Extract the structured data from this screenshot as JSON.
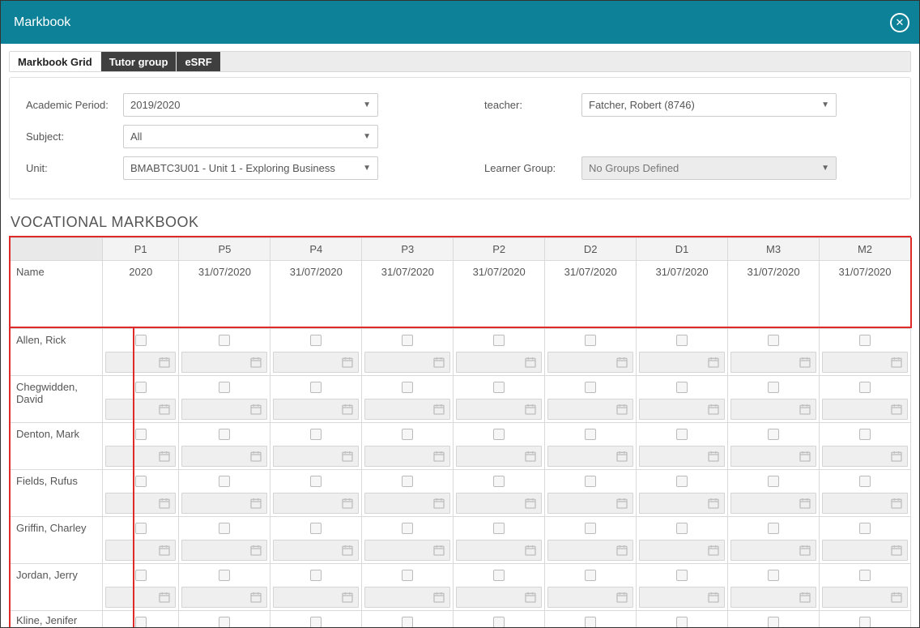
{
  "window": {
    "title": "Markbook"
  },
  "tabs": [
    {
      "label": "Markbook Grid",
      "active": true
    },
    {
      "label": "Tutor group",
      "active": false
    },
    {
      "label": "eSRF",
      "active": false
    }
  ],
  "filters": {
    "academic_period": {
      "label": "Academic Period:",
      "value": "2019/2020"
    },
    "subject": {
      "label": "Subject:",
      "value": "All"
    },
    "unit": {
      "label": "Unit:",
      "value": "BMABTC3U01 - Unit 1 - Exploring Business"
    },
    "teacher": {
      "label": "teacher:",
      "value": "Fatcher, Robert (8746)"
    },
    "learner_group": {
      "label": "Learner Group:",
      "value": "No Groups Defined"
    }
  },
  "section_title": "VOCATIONAL MARKBOOK",
  "markbook": {
    "name_header": "Name",
    "columns": [
      {
        "code": "P1",
        "date": "2020"
      },
      {
        "code": "P5",
        "date": "31/07/2020"
      },
      {
        "code": "P4",
        "date": "31/07/2020"
      },
      {
        "code": "P3",
        "date": "31/07/2020"
      },
      {
        "code": "P2",
        "date": "31/07/2020"
      },
      {
        "code": "D2",
        "date": "31/07/2020"
      },
      {
        "code": "D1",
        "date": "31/07/2020"
      },
      {
        "code": "M3",
        "date": "31/07/2020"
      },
      {
        "code": "M2",
        "date": "31/07/2020"
      }
    ],
    "students": [
      "Allen, Rick",
      "Chegwidden, David",
      "Denton, Mark",
      "Fields, Rufus",
      "Griffin, Charley",
      "Jordan, Jerry",
      "Kline, Jenifer"
    ]
  }
}
